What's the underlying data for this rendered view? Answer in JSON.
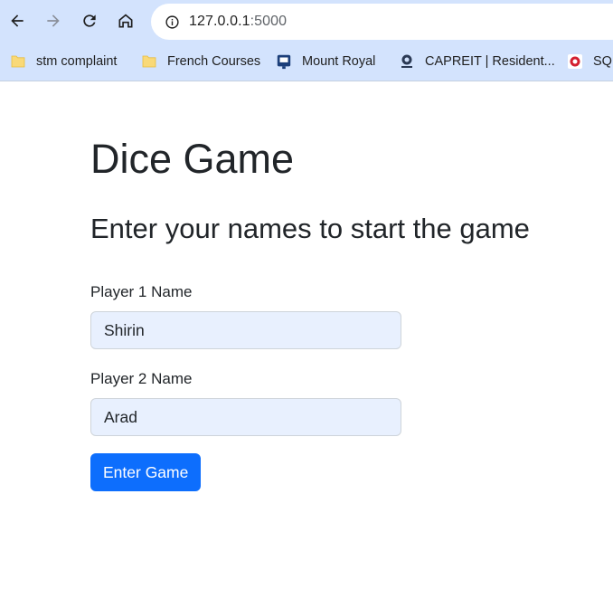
{
  "browser": {
    "url_host": "127.0.0.1",
    "url_port": ":5000",
    "bookmarks": [
      {
        "label": "stm complaint",
        "icon": "folder-icon"
      },
      {
        "label": "French Courses",
        "icon": "folder-icon"
      },
      {
        "label": "Mount Royal",
        "icon": "site-icon"
      },
      {
        "label": "CAPREIT | Resident...",
        "icon": "site-icon"
      },
      {
        "label": "SQ",
        "icon": "site-icon"
      }
    ]
  },
  "page": {
    "title": "Dice Game",
    "subtitle": "Enter your names to start the game",
    "player1_label": "Player 1 Name",
    "player1_value": "Shirin",
    "player2_label": "Player 2 Name",
    "player2_value": "Arad",
    "submit_label": "Enter Game"
  },
  "colors": {
    "chrome_bg": "#d3e3fd",
    "primary": "#0d6efd",
    "autofill_bg": "#e8f0fe"
  }
}
